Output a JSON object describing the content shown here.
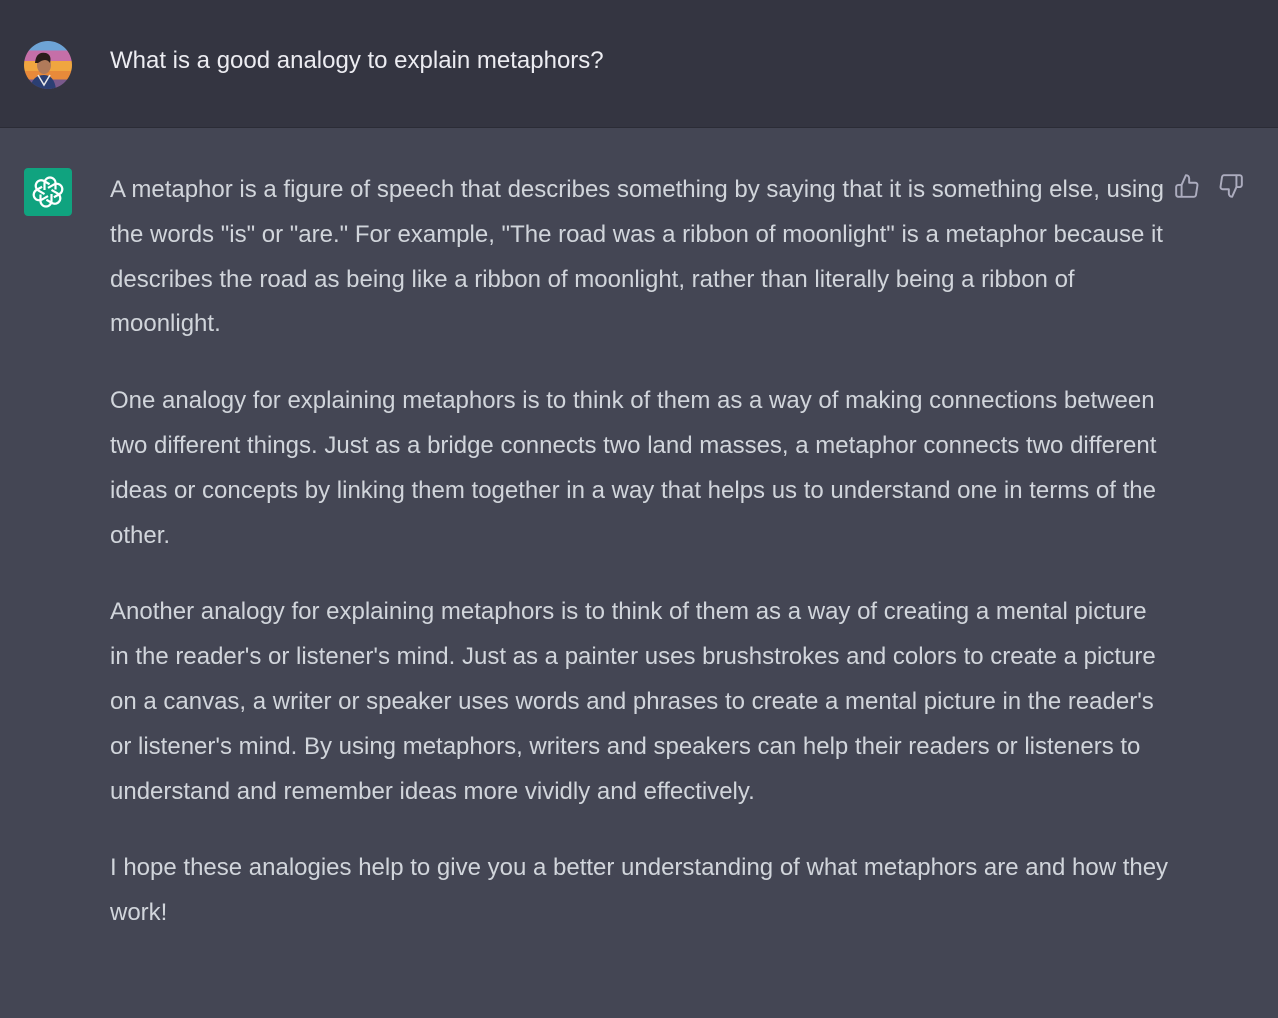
{
  "user_message": {
    "text": "What is a good analogy to explain metaphors?"
  },
  "assistant_message": {
    "paragraphs": [
      "A metaphor is a figure of speech that describes something by saying that it is something else, using the words \"is\" or \"are.\" For example, \"The road was a ribbon of moonlight\" is a metaphor because it describes the road as being like a ribbon of moonlight, rather than literally being a ribbon of moonlight.",
      "One analogy for explaining metaphors is to think of them as a way of making connections between two different things. Just as a bridge connects two land masses, a metaphor connects two different ideas or concepts by linking them together in a way that helps us to understand one in terms of the other.",
      "Another analogy for explaining metaphors is to think of them as a way of creating a mental picture in the reader's or listener's mind. Just as a painter uses brushstrokes and colors to create a picture on a canvas, a writer or speaker uses words and phrases to create a mental picture in the reader's or listener's mind. By using metaphors, writers and speakers can help their readers or listeners to understand and remember ideas more vividly and effectively.",
      "I hope these analogies help to give you a better understanding of what metaphors are and how they work!"
    ]
  },
  "icons": {
    "user_avatar": "user-avatar",
    "assistant_avatar": "openai-logo-icon",
    "thumbs_up": "thumbs-up-icon",
    "thumbs_down": "thumbs-down-icon"
  },
  "colors": {
    "user_row_bg": "#343541",
    "assistant_row_bg": "#444654",
    "assistant_avatar_bg": "#10a37f",
    "user_text": "#ececf1",
    "assistant_text": "#d1d5db",
    "icon": "#acacbe"
  }
}
